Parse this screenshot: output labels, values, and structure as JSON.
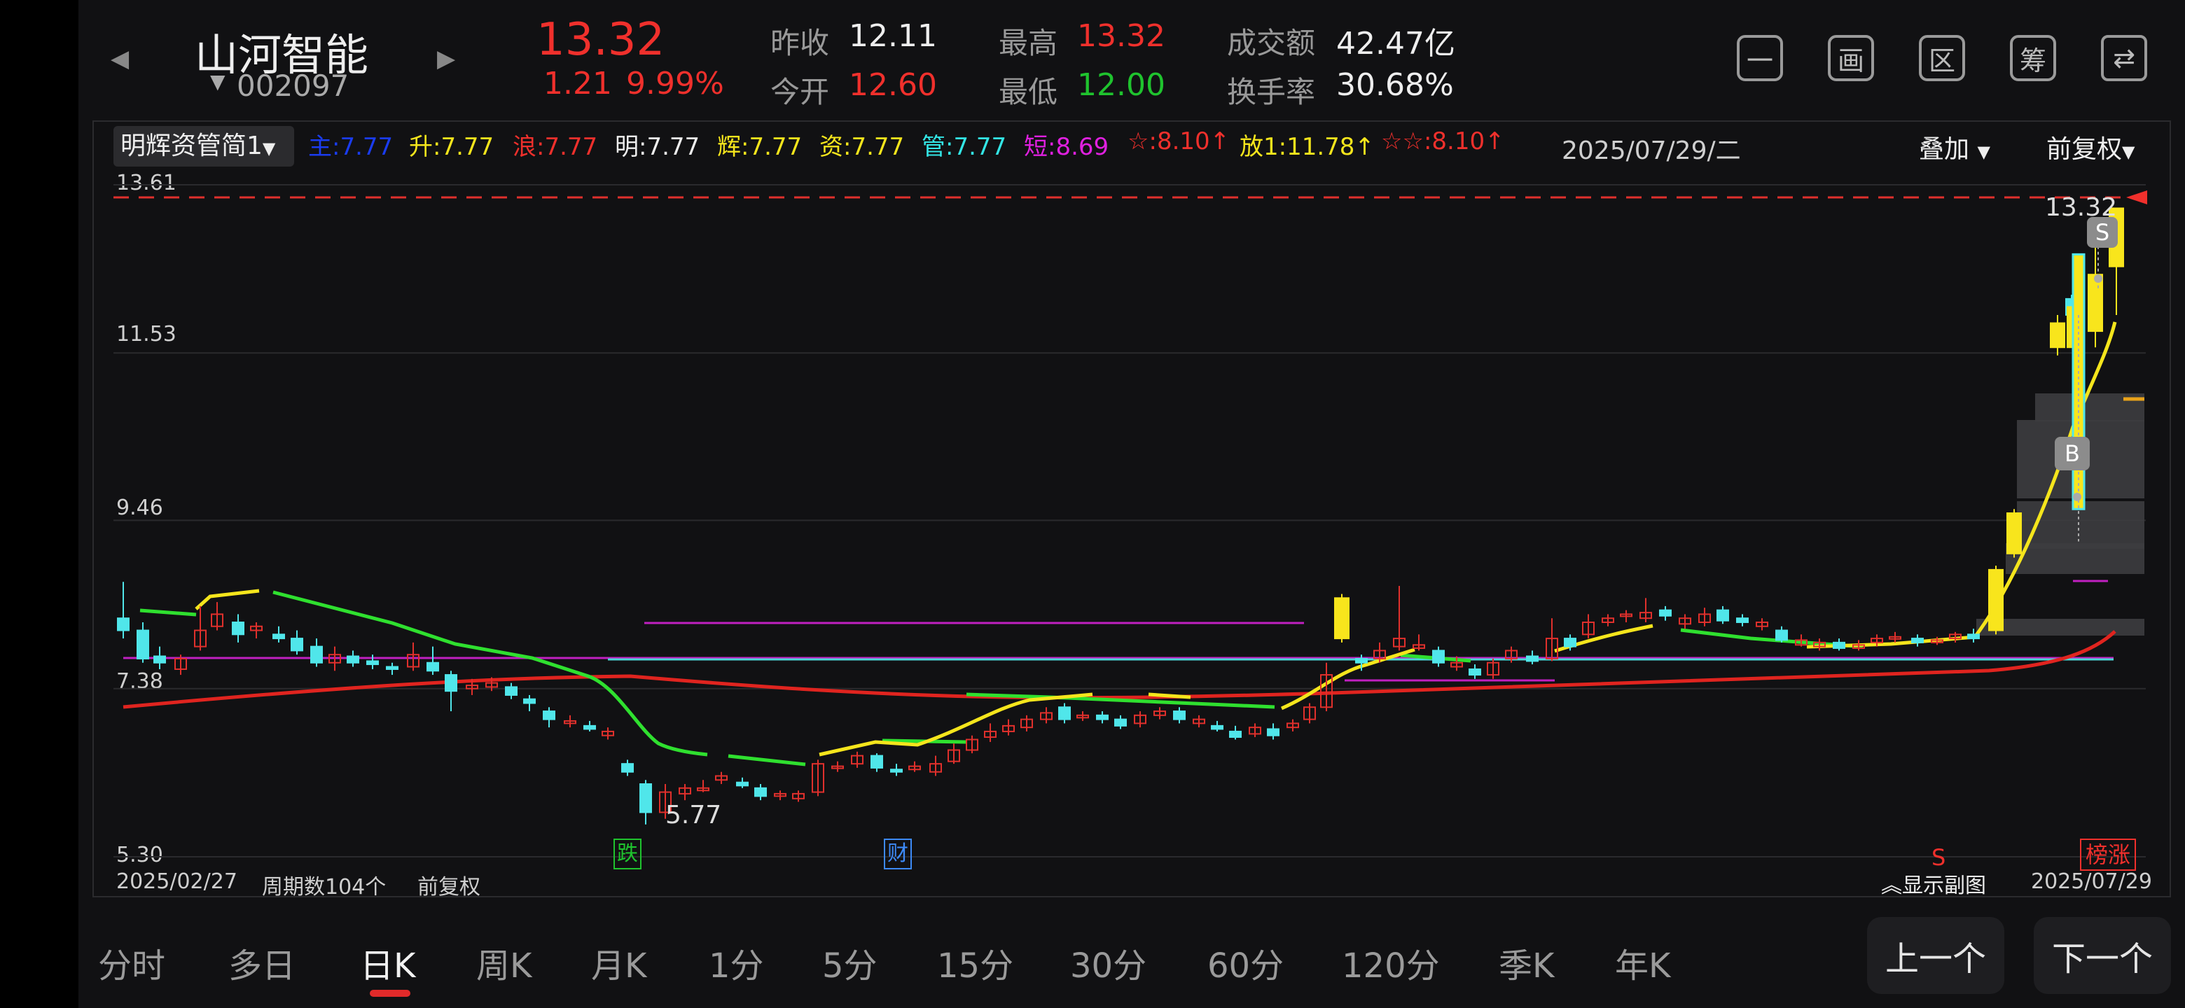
{
  "stock": {
    "name": "山河智能",
    "code": "002097",
    "price": "13.32",
    "change": "1.21",
    "change_pct": "9.99%",
    "stats": {
      "prev_close_label": "昨收",
      "prev_close": "12.11",
      "open_label": "今开",
      "open": "12.60",
      "high_label": "最高",
      "high": "13.32",
      "low_label": "最低",
      "low": "12.00",
      "turnover_label": "成交额",
      "turnover": "42.47亿",
      "rate_label": "换手率",
      "rate": "30.68%"
    }
  },
  "toolbar_icons": [
    "minus-square-icon",
    "draw-icon",
    "region-icon",
    "chip-icon",
    "switch-device-icon"
  ],
  "toolbar_glyphs": [
    "一",
    "画",
    "区",
    "筹",
    "⇄"
  ],
  "indicator": {
    "selector": "明辉资管简1",
    "items": [
      {
        "label": "主:",
        "value": "7.77",
        "color": "#1a3cf0"
      },
      {
        "label": "升:",
        "value": "7.77",
        "color": "#f5e51c"
      },
      {
        "label": "浪:",
        "value": "7.77",
        "color": "#f0302c"
      },
      {
        "label": "明:",
        "value": "7.77",
        "color": "#eeeeee"
      },
      {
        "label": "辉:",
        "value": "7.77",
        "color": "#f5e51c"
      },
      {
        "label": "资:",
        "value": "7.77",
        "color": "#f5e51c"
      },
      {
        "label": "管:",
        "value": "7.77",
        "color": "#33e6e6"
      },
      {
        "label": "短:",
        "value": "8.69",
        "color": "#e020e0"
      },
      {
        "label": "☆:",
        "value": "8.10↑",
        "color": "#f0302c"
      },
      {
        "label": "放1:",
        "value": "11.78↑",
        "color": "#f5e51c"
      },
      {
        "label": "☆☆:",
        "value": "8.10↑",
        "color": "#f0302c"
      }
    ],
    "date": "2025/07/29/二",
    "overlay": "叠加",
    "adjust": "前复权"
  },
  "chart_data": {
    "type": "candlestick",
    "y_ticks": [
      "13.61",
      "11.53",
      "9.46",
      "7.38",
      "5.30"
    ],
    "ylim": [
      5.3,
      13.61
    ],
    "period_count_label": "周期数104个",
    "adjust_label": "前复权",
    "start_date": "2025/02/27",
    "end_date": "2025/07/29",
    "low_marker": "5.77",
    "high_marker": "13.32",
    "event_markers": [
      "跌",
      "财"
    ],
    "signals": [
      "S",
      "B"
    ],
    "bottom_right_marks": [
      "S",
      "榜",
      "涨"
    ],
    "show_sub_label": "显示副图"
  },
  "tabs": [
    "分时",
    "多日",
    "日K",
    "周K",
    "月K",
    "1分",
    "5分",
    "15分",
    "30分",
    "60分",
    "120分",
    "季K",
    "年K"
  ],
  "active_tab": "日K",
  "nav": {
    "prev": "上一个",
    "next": "下一个"
  }
}
